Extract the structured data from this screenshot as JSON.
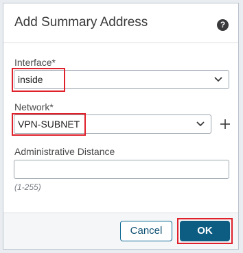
{
  "dialog": {
    "title": "Add Summary Address",
    "help_icon": "question-circle-icon"
  },
  "interface": {
    "label": "Interface",
    "required_mark": "*",
    "value": "inside"
  },
  "network": {
    "label": "Network",
    "required_mark": "*",
    "value": "VPN-SUBNET",
    "add_icon": "plus-icon"
  },
  "admin_distance": {
    "label": "Administrative Distance",
    "value": "",
    "hint": "(1-255)"
  },
  "buttons": {
    "cancel": "Cancel",
    "ok": "OK"
  },
  "colors": {
    "primary": "#0d5d83",
    "highlight": "#e0202a"
  }
}
